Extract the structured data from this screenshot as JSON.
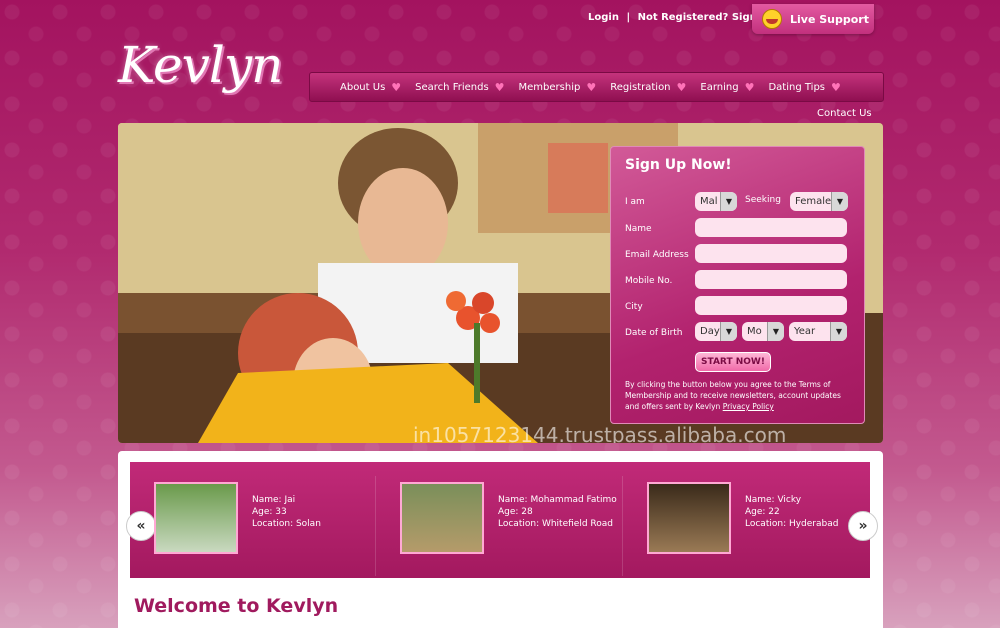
{
  "header": {
    "login": "Login",
    "separator": "|",
    "register": "Not Registered? Sign Up",
    "live_support": "Live Support",
    "logo_text": "Kevlyn"
  },
  "nav": {
    "items": [
      {
        "label": "About Us"
      },
      {
        "label": "Search Friends"
      },
      {
        "label": "Membership"
      },
      {
        "label": "Registration"
      },
      {
        "label": "Earning"
      },
      {
        "label": "Dating Tips"
      }
    ],
    "contact": "Contact Us"
  },
  "hero": {
    "watermark": "in1057123144.trustpass.alibaba.com"
  },
  "signup": {
    "title": "Sign Up Now!",
    "i_am_label": "I am",
    "i_am_value": "Mal",
    "seeking_label": "Seeking",
    "seeking_value": "Female",
    "name_label": "Name",
    "email_label": "Email Address",
    "mobile_label": "Mobile No.",
    "city_label": "City",
    "dob_label": "Date of Birth",
    "dob_day": "Day",
    "dob_month": "Mo",
    "dob_year": "Year",
    "button": "START NOW!",
    "terms": "By clicking the button below you agree to the Terms of Membership and to receive newsletters, account updates and offers sent by Kevlyn",
    "privacy": "Privacy Policy"
  },
  "profiles": [
    {
      "name": "Name: Jai",
      "age": "Age: 33",
      "location": "Location: Solan"
    },
    {
      "name": "Name: Mohammad Fatimo",
      "age": "Age: 28",
      "location": "Location: Whitefield Road"
    },
    {
      "name": "Name: Vicky",
      "age": "Age: 22",
      "location": "Location: Hyderabad"
    }
  ],
  "carousel": {
    "prev": "«",
    "next": "»"
  },
  "welcome": "Welcome to Kevlyn"
}
